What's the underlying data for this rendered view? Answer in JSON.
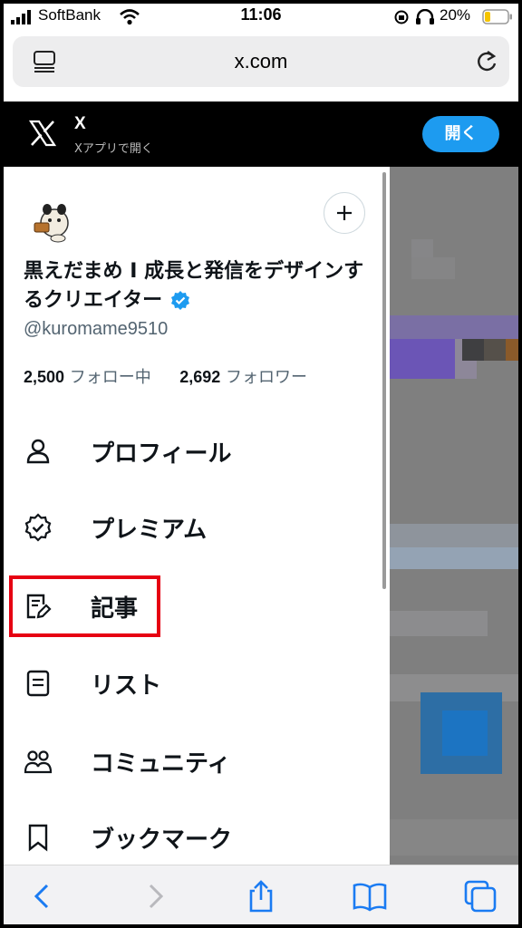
{
  "status_bar": {
    "carrier": "SoftBank",
    "time": "11:06",
    "battery_percent": "20%"
  },
  "browser": {
    "url": "x.com"
  },
  "app_banner": {
    "app_name": "X",
    "subtitle": "Xアプリで開く",
    "open_label": "開く"
  },
  "profile": {
    "display_name": "黒えだまめ I 成長と発信をデザインするクリエイター",
    "handle": "@kuromame9510",
    "following_count": "2,500",
    "following_label": "フォロー中",
    "followers_count": "2,692",
    "followers_label": "フォロワー"
  },
  "menu": {
    "items": [
      {
        "label": "プロフィール",
        "icon": "person-icon"
      },
      {
        "label": "プレミアム",
        "icon": "verified-badge-icon"
      },
      {
        "label": "記事",
        "icon": "article-edit-icon",
        "highlighted": true
      },
      {
        "label": "リスト",
        "icon": "list-icon"
      },
      {
        "label": "コミュニティ",
        "icon": "community-icon"
      },
      {
        "label": "ブックマーク",
        "icon": "bookmark-icon"
      }
    ]
  },
  "colors": {
    "accent": "#1d9bf0",
    "highlight_box": "#e60012",
    "text_primary": "#0f1419",
    "text_secondary": "#536471"
  }
}
